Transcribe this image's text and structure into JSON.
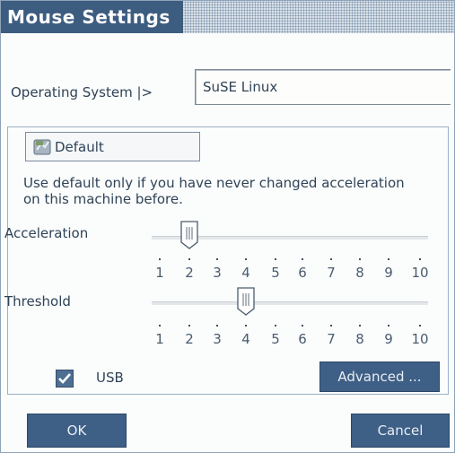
{
  "dialog": {
    "title": "Mouse Settings"
  },
  "os": {
    "label": "Operating System |>",
    "value": "SuSE Linux"
  },
  "default_button": {
    "label": "Default",
    "icon": "default-reset-icon"
  },
  "hint": "Use default only if you have never changed acceleration on this machine before.",
  "acceleration": {
    "label": "Acceleration",
    "value": 2,
    "scale": [
      "1",
      "2",
      "3",
      "4",
      "5",
      "6",
      "7",
      "8",
      "9",
      "10"
    ]
  },
  "threshold": {
    "label": "Threshold",
    "value": 4,
    "scale": [
      "1",
      "2",
      "3",
      "4",
      "5",
      "6",
      "7",
      "8",
      "9",
      "10"
    ]
  },
  "usb": {
    "label": "USB",
    "checked": true
  },
  "buttons": {
    "advanced": "Advanced ...",
    "ok": "OK",
    "cancel": "Cancel"
  },
  "colors": {
    "title_bg": "#3d5d80",
    "button_bg": "#3e5f86",
    "text": "#2f4357"
  }
}
